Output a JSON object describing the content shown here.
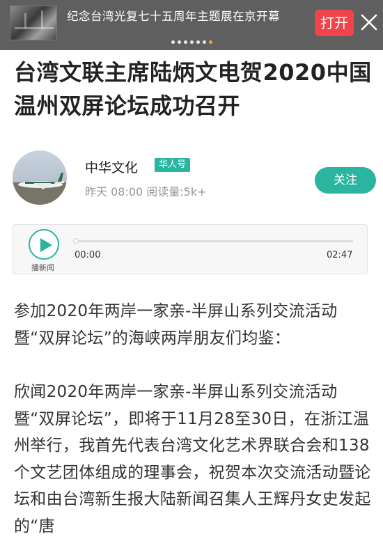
{
  "banner": {
    "title": "纪念台湾光复七十五周年主题展在京开幕",
    "open_label": "打开",
    "close_icon": "close-icon",
    "dots_count": 7,
    "active_dot": 6
  },
  "article": {
    "title": "台湾文联主席陆炳文电贺2020中国温州双屏论坛成功召开"
  },
  "author": {
    "name": "中华文化",
    "badge": "华人号",
    "meta": "昨天 08:00 阅读量:5k+",
    "follow_label": "关注"
  },
  "player": {
    "play_label": "播新闻",
    "time_start": "00:00",
    "time_end": "02:47",
    "progress": 0
  },
  "body": {
    "para1": "参加2020年两岸一家亲-半屏山系列交流活动暨“双屏论坛”的海峡两岸朋友们均鉴：",
    "para2": "欣闻2020年两岸一家亲-半屏山系列交流活动暨“双屏论坛”，即将于11月28至30日，在浙江温州举行，我首先代表台湾文化艺术界联合会和138个文艺团体组成的理事会，祝贺本次交流活动暨论坛和由台湾新生报大陆新闻召集人王辉丹女史发起的“唐"
  },
  "colors": {
    "accent": "#2bb5a0",
    "open_button": "#f0444d",
    "banner_bg": "#5f5f5f"
  }
}
